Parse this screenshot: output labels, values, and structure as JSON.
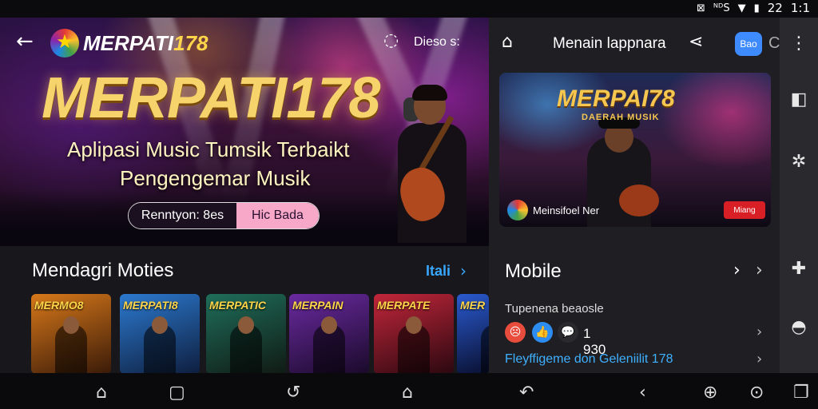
{
  "status_bar": {
    "icons": [
      "nfc-icon",
      "signal-icon",
      "wifi-icon",
      "battery-icon"
    ],
    "icon_glyphs": [
      "⊠",
      "ᴺᴰS",
      "▼",
      "▮"
    ],
    "level": "22",
    "time": "1:1"
  },
  "app": {
    "brand_name": "MERPATI",
    "brand_number": "178",
    "topbar_label": "Dieso s:",
    "hero": {
      "title": "MERPATI178",
      "subtitle_line1": "Aplipasi Music Tumsik Terbaikt",
      "subtitle_line2": "Pengengemar Musik",
      "cta_left": "Renntyon: 8es",
      "cta_right": "Hic Bada"
    },
    "section": {
      "title": "Mendagri Moties",
      "more_label": "Itali"
    },
    "thumbnails": [
      {
        "label": "MERMO8",
        "colors": [
          "#d8791a",
          "#3a1a08"
        ]
      },
      {
        "label": "MERPATI8",
        "colors": [
          "#2c7ad0",
          "#0e1e3e"
        ]
      },
      {
        "label": "MERPATIC",
        "colors": [
          "#1f6e5a",
          "#101a14"
        ]
      },
      {
        "label": "MERPAIN",
        "colors": [
          "#6a2aa0",
          "#1a0a2a"
        ]
      },
      {
        "label": "MERPATE",
        "colors": [
          "#c2263a",
          "#2a0810"
        ]
      },
      {
        "label": "MER",
        "colors": [
          "#2a5ad0",
          "#0a1030"
        ]
      }
    ]
  },
  "right_panel": {
    "title": "Menain lappnara",
    "pill_label": "Bao",
    "pill_suffix": "C",
    "video": {
      "title": "MERPAI78",
      "subtitle": "DAERAH MUSIK",
      "channel": "Meinsifoel Ner",
      "badge": "Miang"
    },
    "section_title": "Mobile",
    "caption": "Tupenena beaosle",
    "reactions": [
      {
        "name": "angry-face-icon",
        "glyph": "☹",
        "color": "#e74c3c"
      },
      {
        "name": "like-icon",
        "glyph": "👍",
        "color": "#2d8cf0"
      },
      {
        "name": "chat-bubble-icon",
        "glyph": "💬",
        "color": "#2a2a2e"
      }
    ],
    "reaction_count": "1 930",
    "link_text": "Fleyffigeme don Geleniilit 178"
  },
  "rail_icons": [
    "more-vert-icon",
    "tab-icon",
    "settings-icon",
    "widgets-icon",
    "support-icon"
  ],
  "nav_icons": [
    "home-icon",
    "recents-icon",
    "back-icon",
    "home-filled-icon",
    "undo-icon",
    "back-arrow-icon",
    "download-icon",
    "search-icon",
    "copy-icon"
  ]
}
